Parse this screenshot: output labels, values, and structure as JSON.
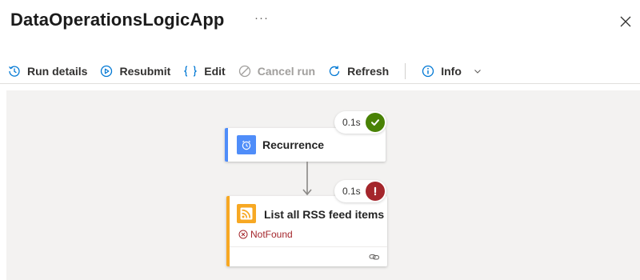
{
  "header": {
    "title": "DataOperationsLogicApp",
    "more_label": "···"
  },
  "toolbar": {
    "run_details_label": "Run details",
    "resubmit_label": "Resubmit",
    "edit_label": "Edit",
    "cancel_run_label": "Cancel run",
    "refresh_label": "Refresh",
    "info_label": "Info"
  },
  "workflow": {
    "steps": [
      {
        "title": "Recurrence",
        "duration": "0.1s",
        "status": "succeeded",
        "icon": "alarm-clock-icon",
        "accent_color": "#4f8df9",
        "status_color": "#498205"
      },
      {
        "title": "List all RSS feed items",
        "duration": "0.1s",
        "status": "failed",
        "error_text": "NotFound",
        "icon": "rss-icon",
        "accent_color": "#f7a823",
        "status_color": "#a4262c"
      }
    ]
  },
  "colors": {
    "accent_blue": "#0078d4",
    "canvas_bg": "#f3f2f1",
    "error_red": "#a4262c",
    "success_green": "#498205"
  }
}
